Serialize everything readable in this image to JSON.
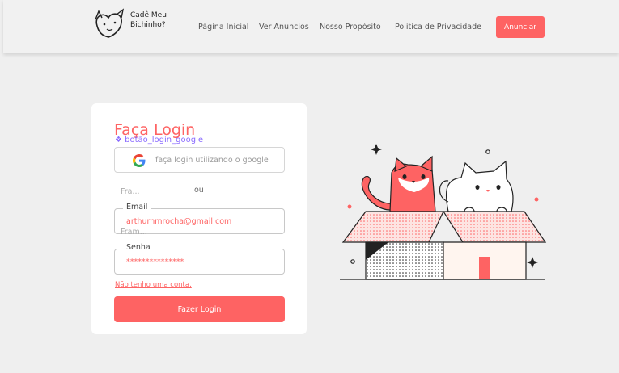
{
  "header": {
    "logo_text": "Cadê Meu Bichinho?",
    "nav": [
      {
        "label": "Página Inicial"
      },
      {
        "label": "Ver Anuncios"
      },
      {
        "label": "Nosso Propósito"
      },
      {
        "label": "Politica de Privacidade"
      }
    ],
    "cta_label": "Anunciar"
  },
  "colors": {
    "accent": "#fe6363",
    "background": "#efefef",
    "card": "#ffffff",
    "debug": "#8a6bff"
  },
  "login": {
    "title": "Faça Login",
    "debug_label": "❖ botão_login_google",
    "google_button": {
      "label": "faça login utilizando o google",
      "icon": "google-icon"
    },
    "ghost_frame_1": "Fra...",
    "ghost_frame_2": "Fram...",
    "divider_text": "ou",
    "email": {
      "label": "Email",
      "value": "arthurnmrocha@gmail.com"
    },
    "password": {
      "label": "Senha",
      "value": "***************"
    },
    "no_account_link": "Não tenho uma conta.",
    "submit_label": "Fazer Login"
  },
  "illustration": {
    "name": "cats-in-box-illustration"
  }
}
